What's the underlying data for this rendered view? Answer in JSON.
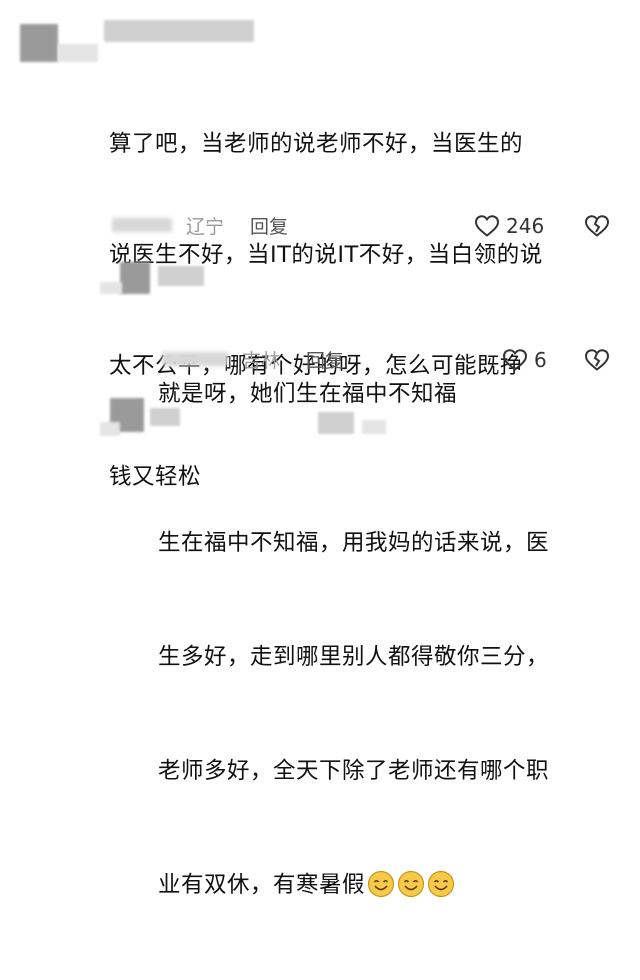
{
  "comments": [
    {
      "text_lines": [
        "算了吧，当老师的说老师不好，当医生的",
        "说医生不好，当IT的说IT不好，当白领的说",
        "太不公平，哪有个好的呀，怎么可能既挣",
        "钱又轻松"
      ],
      "location": "辽宁",
      "reply_label": "回复",
      "like_count": "246"
    },
    {
      "text_lines": [
        "就是呀，她们生在福中不知福"
      ],
      "location": "吉林",
      "reply_label": "回复",
      "like_count": "6"
    },
    {
      "text_lines": [
        "生在福中不知福，用我妈的话来说，医",
        "生多好，走到哪里别人都得敬你三分，",
        "老师多好，全天下除了老师还有哪个职",
        "业有双休，有寒暑假"
      ]
    }
  ],
  "colors": {
    "text": "#111111",
    "meta": "#9a9a9a",
    "icon": "#333333",
    "emoji_face": "#f7c948"
  },
  "icons": {
    "like": "heart-outline-icon",
    "dislike": "broken-heart-icon",
    "emoji": "smile-emoji-icon"
  }
}
